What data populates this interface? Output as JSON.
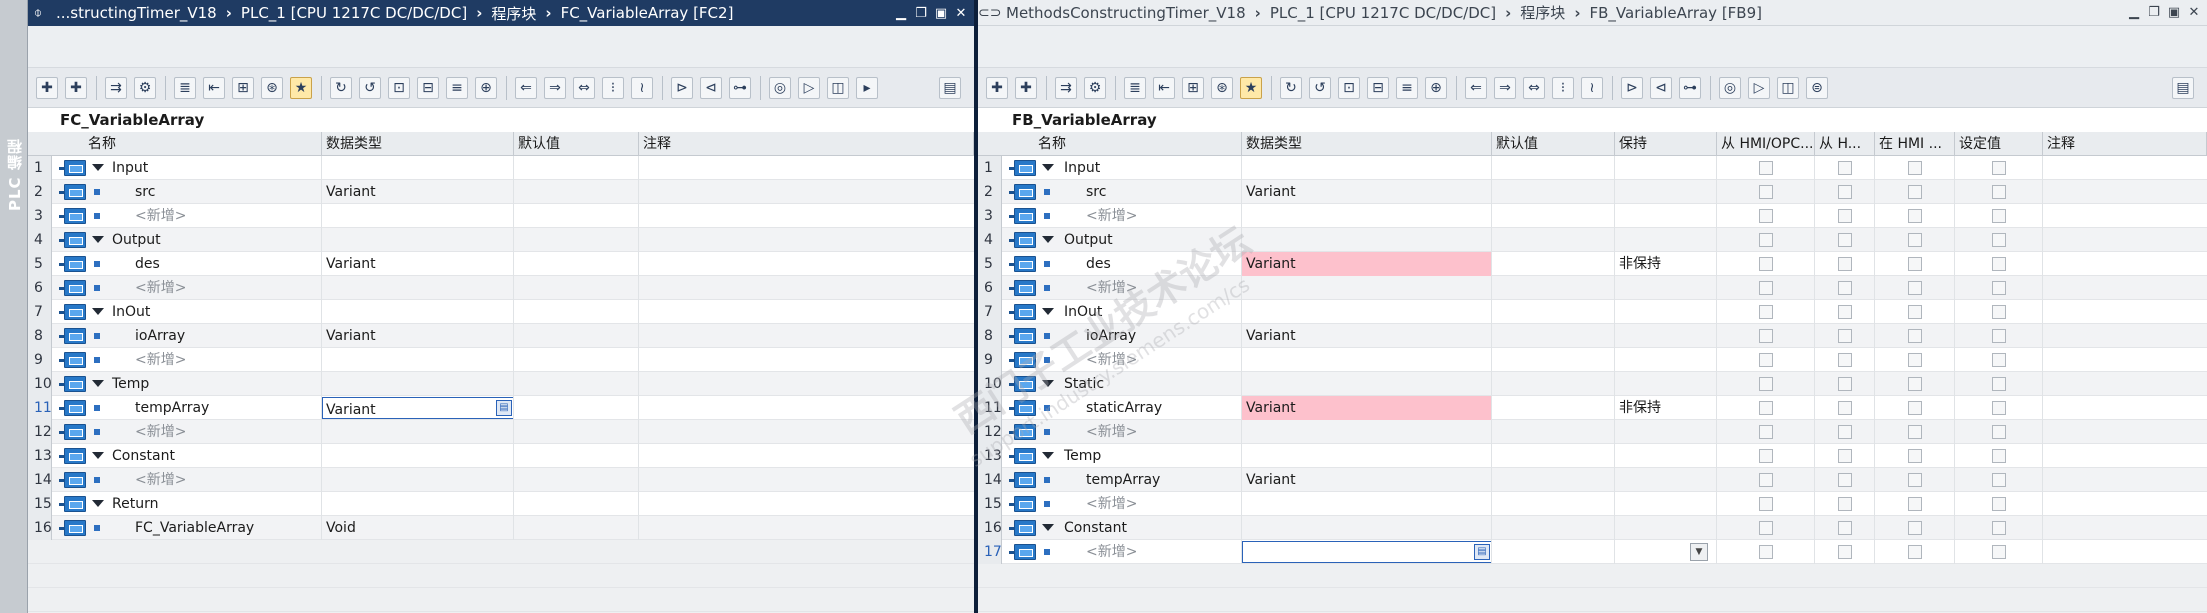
{
  "sidetab": {
    "label": "PLC 编程"
  },
  "left": {
    "breadcrumb": [
      "...structingTimer_V18",
      "PLC_1 [CPU 1217C DC/DC/DC]",
      "程序块",
      "FC_VariableArray [FC2]"
    ],
    "block_title": "FC_VariableArray",
    "columns": [
      "名称",
      "数据类型",
      "默认值",
      "注释"
    ],
    "rows": [
      {
        "num": "1",
        "kind": "section",
        "name": "Input",
        "type": ""
      },
      {
        "num": "2",
        "kind": "var",
        "name": "src",
        "type": "Variant"
      },
      {
        "num": "3",
        "kind": "add",
        "name": "<新增>",
        "type": ""
      },
      {
        "num": "4",
        "kind": "section",
        "name": "Output",
        "type": ""
      },
      {
        "num": "5",
        "kind": "var",
        "name": "des",
        "type": "Variant"
      },
      {
        "num": "6",
        "kind": "add",
        "name": "<新增>",
        "type": ""
      },
      {
        "num": "7",
        "kind": "section",
        "name": "InOut",
        "type": ""
      },
      {
        "num": "8",
        "kind": "var",
        "name": "ioArray",
        "type": "Variant"
      },
      {
        "num": "9",
        "kind": "add",
        "name": "<新增>",
        "type": ""
      },
      {
        "num": "10",
        "kind": "section",
        "name": "Temp",
        "type": ""
      },
      {
        "num": "11",
        "kind": "var",
        "name": "tempArray",
        "type": "Variant",
        "editing": true
      },
      {
        "num": "12",
        "kind": "add",
        "name": "<新增>",
        "type": ""
      },
      {
        "num": "13",
        "kind": "section",
        "name": "Constant",
        "type": ""
      },
      {
        "num": "14",
        "kind": "add",
        "name": "<新增>",
        "type": ""
      },
      {
        "num": "15",
        "kind": "section",
        "name": "Return",
        "type": ""
      },
      {
        "num": "16",
        "kind": "var",
        "name": "FC_VariableArray",
        "type": "Void"
      }
    ]
  },
  "right": {
    "breadcrumb": [
      "MethodsConstructingTimer_V18",
      "PLC_1 [CPU 1217C DC/DC/DC]",
      "程序块",
      "FB_VariableArray [FB9]"
    ],
    "block_title": "FB_VariableArray",
    "columns": [
      "名称",
      "数据类型",
      "默认值",
      "保持",
      "从 HMI/OPC...",
      "从 H...",
      "在 HMI ...",
      "设定值",
      "注释"
    ],
    "rows": [
      {
        "num": "1",
        "kind": "section",
        "name": "Input",
        "type": "",
        "retain": ""
      },
      {
        "num": "2",
        "kind": "var",
        "name": "src",
        "type": "Variant",
        "retain": ""
      },
      {
        "num": "3",
        "kind": "add",
        "name": "<新增>",
        "type": "",
        "retain": ""
      },
      {
        "num": "4",
        "kind": "section",
        "name": "Output",
        "type": "",
        "retain": ""
      },
      {
        "num": "5",
        "kind": "var",
        "name": "des",
        "type": "Variant",
        "retain": "非保持",
        "error": true
      },
      {
        "num": "6",
        "kind": "add",
        "name": "<新增>",
        "type": "",
        "retain": ""
      },
      {
        "num": "7",
        "kind": "section",
        "name": "InOut",
        "type": "",
        "retain": ""
      },
      {
        "num": "8",
        "kind": "var",
        "name": "ioArray",
        "type": "Variant",
        "retain": ""
      },
      {
        "num": "9",
        "kind": "add",
        "name": "<新增>",
        "type": "",
        "retain": ""
      },
      {
        "num": "10",
        "kind": "section",
        "name": "Static",
        "type": "",
        "retain": ""
      },
      {
        "num": "11",
        "kind": "var",
        "name": "staticArray",
        "type": "Variant",
        "retain": "非保持",
        "error": true
      },
      {
        "num": "12",
        "kind": "add",
        "name": "<新增>",
        "type": "",
        "retain": ""
      },
      {
        "num": "13",
        "kind": "section",
        "name": "Temp",
        "type": "",
        "retain": ""
      },
      {
        "num": "14",
        "kind": "var",
        "name": "tempArray",
        "type": "Variant",
        "retain": ""
      },
      {
        "num": "15",
        "kind": "add",
        "name": "<新增>",
        "type": "",
        "retain": ""
      },
      {
        "num": "16",
        "kind": "section",
        "name": "Constant",
        "type": "",
        "retain": ""
      },
      {
        "num": "17",
        "kind": "add",
        "name": "<新增>",
        "type": "",
        "retain": "",
        "editing": true
      }
    ]
  },
  "watermark": {
    "line1": "西门子工业技术论坛",
    "line2": "support.industry.siemens.com/cs"
  }
}
